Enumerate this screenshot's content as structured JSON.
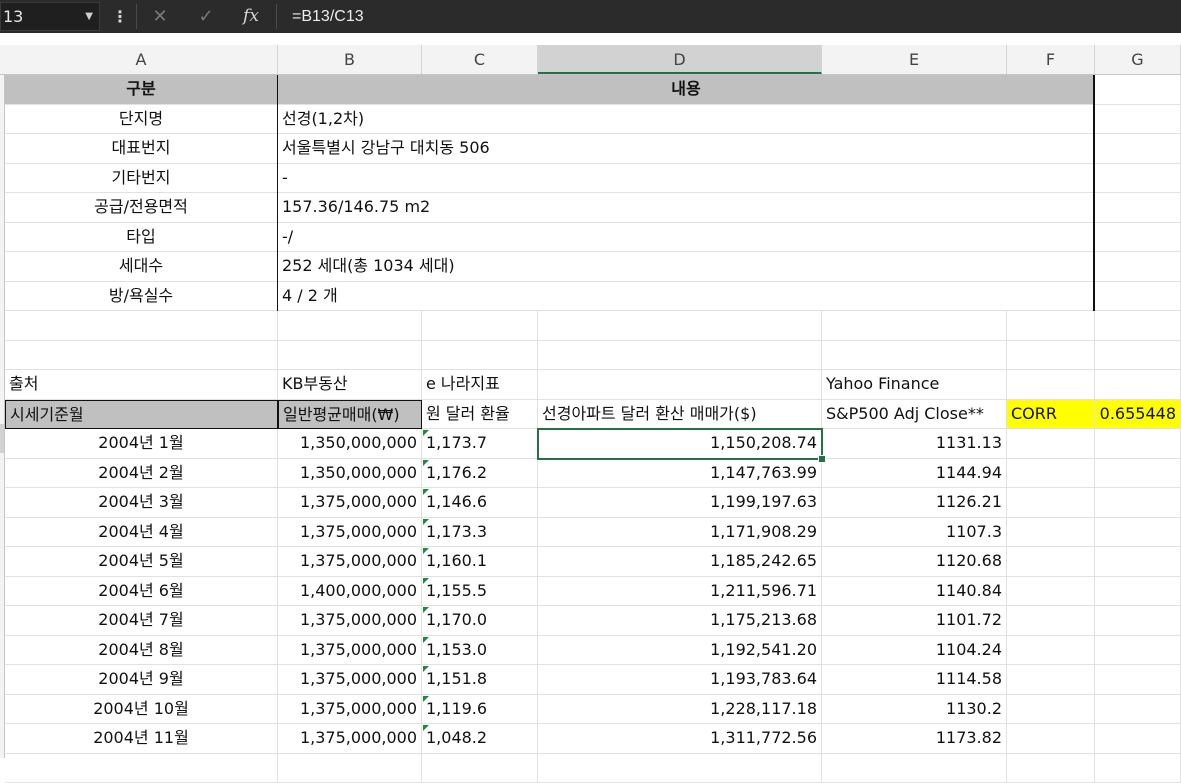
{
  "formula_bar": {
    "name_box": "13",
    "formula": "=B13/C13",
    "icons": [
      "dropdown-caret-icon",
      "more-options-icon",
      "cancel-icon",
      "enter-icon",
      "insert-function-icon"
    ]
  },
  "columns": [
    "A",
    "B",
    "C",
    "D",
    "E",
    "F",
    "G"
  ],
  "selected_column": "D",
  "info": {
    "header": [
      "구분",
      "내용"
    ],
    "rows": [
      [
        "단지명",
        "선경(1,2차)"
      ],
      [
        "대표번지",
        "서울특별시 강남구 대치동 506"
      ],
      [
        "기타번지",
        "-"
      ],
      [
        "공급/전용면적",
        "157.36/146.75 m2"
      ],
      [
        "타입",
        "-/"
      ],
      [
        "세대수",
        "252 세대(총 1034 세대)"
      ],
      [
        "방/욕실수",
        "4 / 2 개"
      ]
    ]
  },
  "sources": {
    "a": "출처",
    "b": "KB부동산",
    "c": "e 나라지표",
    "e": "Yahoo Finance"
  },
  "table_header": {
    "a": "시세기준월",
    "b": "일반평균매매(₩)",
    "c": "원 달러 환율",
    "d": "선경아파트 달러 환산 매매가($)",
    "e": "S&P500 Adj Close**",
    "f": "CORR",
    "g": "0.655448"
  },
  "rows": [
    [
      "2004년 1월",
      "1,350,000,000",
      "1,173.7",
      "1,150,208.74",
      "1131.13"
    ],
    [
      "2004년 2월",
      "1,350,000,000",
      "1,176.2",
      "1,147,763.99",
      "1144.94"
    ],
    [
      "2004년 3월",
      "1,375,000,000",
      "1,146.6",
      "1,199,197.63",
      "1126.21"
    ],
    [
      "2004년 4월",
      "1,375,000,000",
      "1,173.3",
      "1,171,908.29",
      "1107.3"
    ],
    [
      "2004년 5월",
      "1,375,000,000",
      "1,160.1",
      "1,185,242.65",
      "1120.68"
    ],
    [
      "2004년 6월",
      "1,400,000,000",
      "1,155.5",
      "1,211,596.71",
      "1140.84"
    ],
    [
      "2004년 7월",
      "1,375,000,000",
      "1,170.0",
      "1,175,213.68",
      "1101.72"
    ],
    [
      "2004년 8월",
      "1,375,000,000",
      "1,153.0",
      "1,192,541.20",
      "1104.24"
    ],
    [
      "2004년 9월",
      "1,375,000,000",
      "1,151.8",
      "1,193,783.64",
      "1114.58"
    ],
    [
      "2004년 10월",
      "1,375,000,000",
      "1,119.6",
      "1,228,117.18",
      "1130.2"
    ],
    [
      "2004년 11월",
      "1,375,000,000",
      "1,048.2",
      "1,311,772.56",
      "1173.82"
    ]
  ],
  "colors": {
    "accent": "#217346",
    "header_gray": "#c0c0c0",
    "highlight": "#ffff00",
    "error_triangle": "#1e8a3c"
  }
}
